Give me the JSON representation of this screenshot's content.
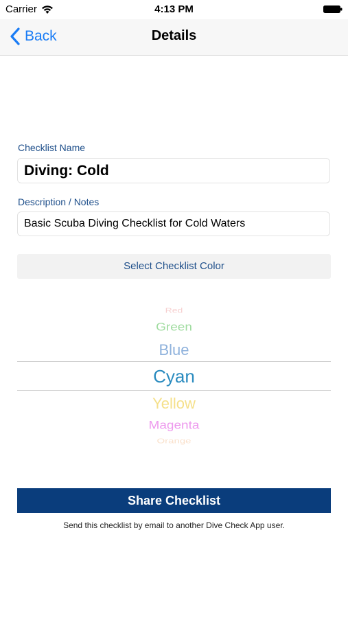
{
  "status_bar": {
    "carrier": "Carrier",
    "time": "4:13 PM"
  },
  "nav": {
    "back_label": "Back",
    "title": "Details"
  },
  "form": {
    "name_label": "Checklist Name",
    "name_value": "Diving: Cold",
    "description_label": "Description / Notes",
    "description_value": "Basic Scuba Diving Checklist for Cold Waters",
    "color_button_label": "Select Checklist Color"
  },
  "picker": {
    "options": [
      "Red",
      "Green",
      "Blue",
      "Cyan",
      "Yellow",
      "Magenta",
      "Orange"
    ],
    "selected": "Cyan",
    "colors": {
      "Red": "#f0a8a8",
      "Green": "#8fd68f",
      "Blue": "#8fb2dc",
      "Cyan": "#2a8bbf",
      "Yellow": "#f5e08a",
      "Magenta": "#ec8eec",
      "Orange": "#f6c9a3"
    }
  },
  "share": {
    "button_label": "Share Checklist",
    "caption": "Send this checklist by email to another Dive Check App user."
  },
  "theme": {
    "accent": "#1a7cf5",
    "label_color": "#1d4e8a",
    "share_button_bg": "#0a3d7c"
  }
}
